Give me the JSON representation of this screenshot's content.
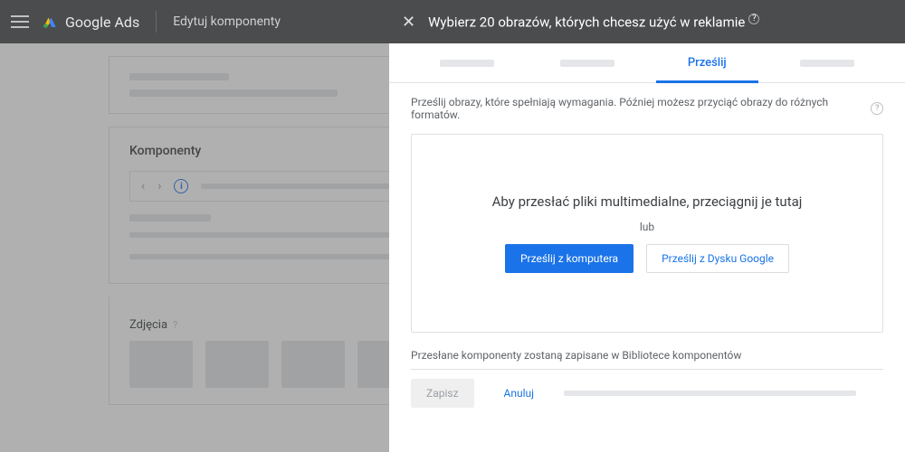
{
  "topbar": {
    "brand": "Google Ads",
    "crumb": "Edytuj komponenty"
  },
  "underlay": {
    "section1_title": "Komponenty",
    "section2_title": "Zdjęcia"
  },
  "panel": {
    "title": "Wybierz 20 obrazów, których chcesz użyć w reklamie",
    "tabs": {
      "upload": "Prześlij"
    },
    "hint": "Prześlij obrazy, które spełniają wymagania. Później możesz przyciąć obrazy do różnych formatów.",
    "dropzone": {
      "main": "Aby przesłać pliki multimedialne, przeciągnij je tutaj",
      "or": "lub",
      "upload_computer": "Prześlij z komputera",
      "upload_drive": "Prześlij z Dysku Google"
    },
    "saved_note": "Przesłane komponenty zostaną zapisane w Bibliotece komponentów",
    "footer": {
      "save": "Zapisz",
      "cancel": "Anuluj"
    }
  }
}
